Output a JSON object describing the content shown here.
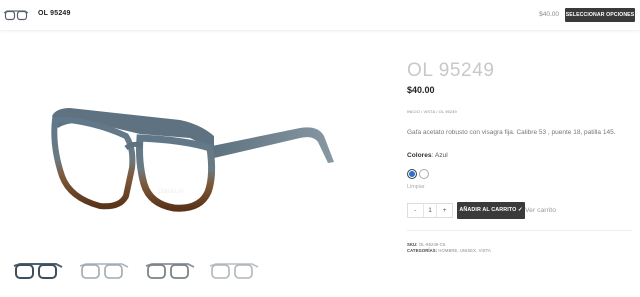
{
  "header": {
    "product_name": "OL 95249",
    "price": "$40.00",
    "options_button": "SELECCIONAR OPCIONES",
    "thumb_icon": "glasses-thumbnail"
  },
  "gallery": {
    "main_image": "glasses-photo",
    "frame_color_top": "#5f7281",
    "frame_color_bottom": "#7a4a2a",
    "thumbnails": [
      "glasses-blue-thumb",
      "glasses-clear-thumb",
      "glasses-grey-thumb",
      "glasses-light-thumb"
    ]
  },
  "product": {
    "title": "OL 95249",
    "price": "$40.00",
    "breadcrumb": "INICIO / VISTA / OL 95249",
    "description": "Gafa acetato robusto con visagra fija. Calibre 53 , puente 18, patilla 145.",
    "color_label": "Colores",
    "color_value": ": Azul",
    "colors": [
      {
        "name": "Azul",
        "hex": "#2f6fcf",
        "selected": true
      },
      {
        "name": "Blanco",
        "hex": "#ffffff",
        "selected": false
      }
    ],
    "clear_label": "Limpiar",
    "quantity": "1",
    "minus": "-",
    "plus": "+",
    "add_to_cart": "AÑADIR AL CARRITO",
    "view_cart": "Ver carrito",
    "sku_label": "SKU:",
    "sku_value": "OL-95249-C5",
    "categories_label": "CATEGORÍAS:",
    "categories_value": "HOMBRE, UNISEX, VISTA"
  }
}
